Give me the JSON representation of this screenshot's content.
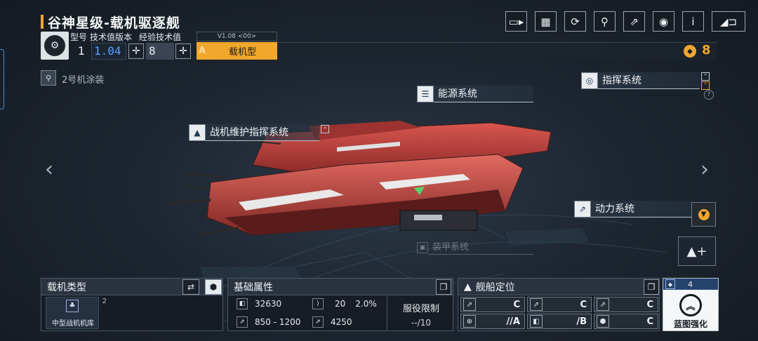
{
  "header": {
    "title": "谷神星级-载机驱逐舰",
    "model_label": "型号",
    "tech_version_label": "技术值版本",
    "exp_tech_label": "经验技术值",
    "model_value": "1",
    "tech_version_value": "1.04",
    "exp_tech_value": "8",
    "version_tag": "V1.08 <00>",
    "grade": "A",
    "ship_type": "载机型",
    "cost": "8"
  },
  "top_icons": [
    "camera-icon",
    "blueprint-icon",
    "refresh-icon",
    "paint-icon",
    "share-icon",
    "view-icon",
    "info-icon",
    "back-icon"
  ],
  "paint": {
    "label": "2号机涂装"
  },
  "systems": {
    "command": "指挥系统",
    "energy": "能源系统",
    "fighter_maintenance": "战机维护指挥系统",
    "power": "动力系统",
    "armor": "装甲系统"
  },
  "bottom": {
    "aircraft_type": {
      "title": "载机类型",
      "count": "2",
      "item_label": "中型战机机库"
    },
    "basic_attrs": {
      "title": "基础属性",
      "hp": "32630",
      "armor": "20",
      "armor_pct": "2.0%",
      "speed": "850 - 1200",
      "fuel": "4250",
      "service_limit_label": "服役限制",
      "service_limit_value": "--/10"
    },
    "positioning": {
      "title": "舰船定位",
      "roles": [
        "C",
        "C",
        "C",
        "//A",
        "/B",
        "C"
      ]
    },
    "blueprint": {
      "level": "4",
      "label": "蓝图强化"
    }
  },
  "colors": {
    "accent": "#f0a531",
    "ship_red": "#c94a44",
    "tech_blue": "#5aa0ff"
  }
}
